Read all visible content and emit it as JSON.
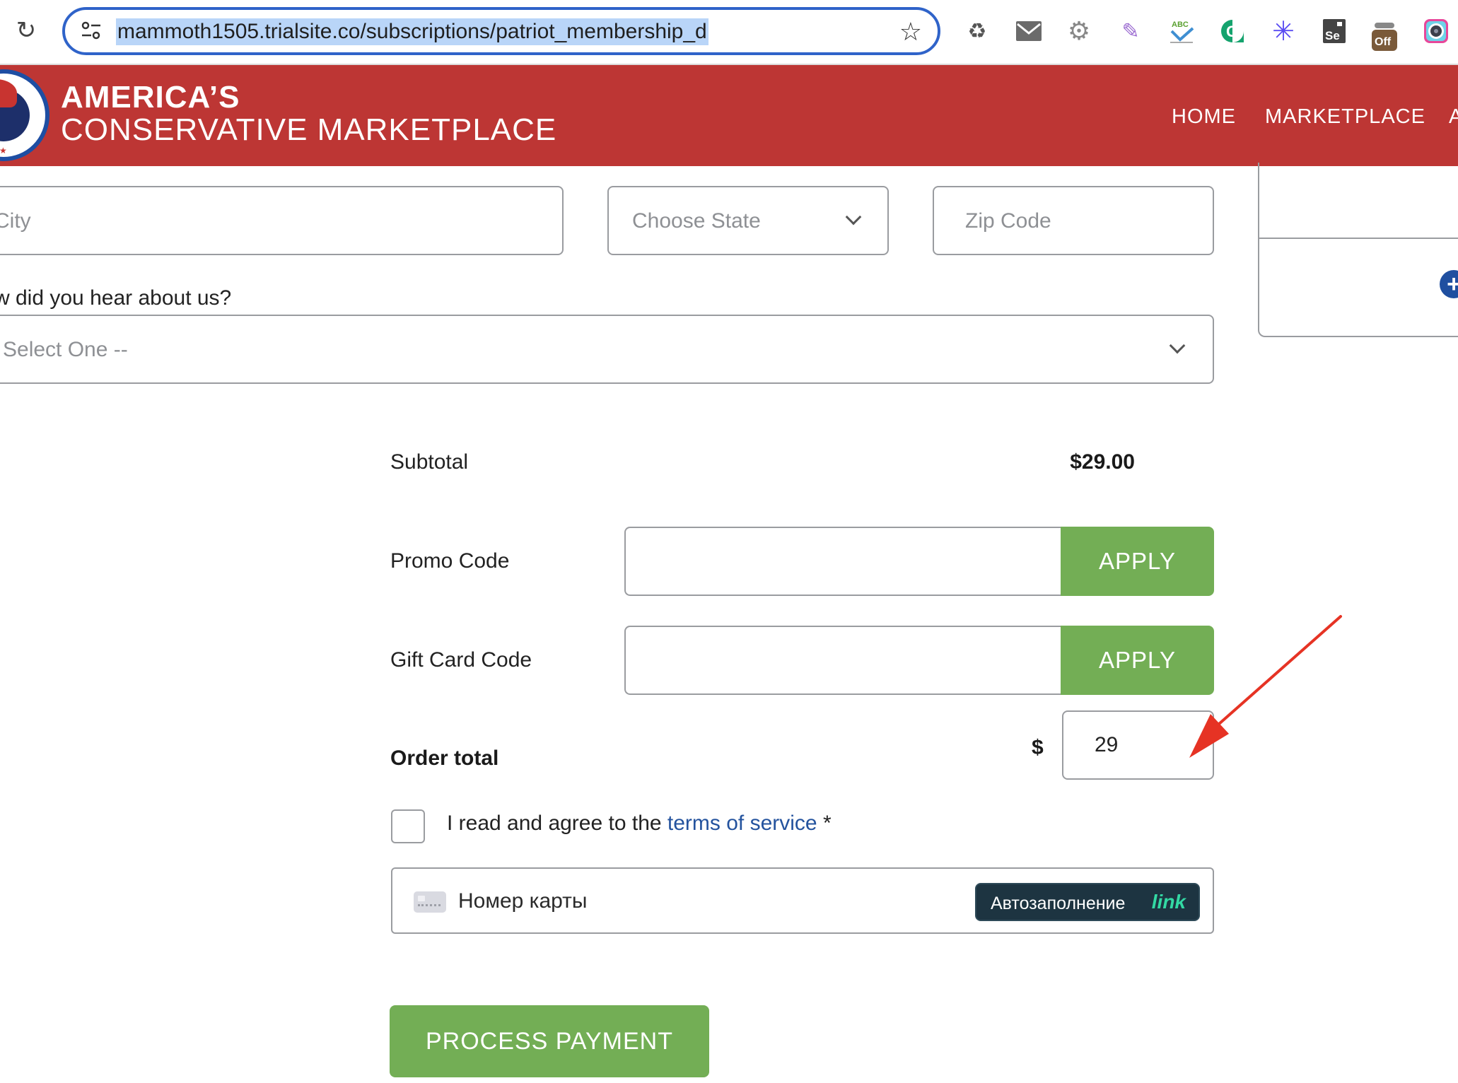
{
  "browser": {
    "url": "mammoth1505.trialsite.co/subscriptions/patriot_membership_d",
    "reload_icon": "reload-icon",
    "site_settings_icon": "tune-icon",
    "bookmark_icon": "star-icon",
    "extensions": [
      {
        "name": "recycle-extension",
        "glyph": "♻"
      },
      {
        "name": "mail-extension",
        "glyph": "✉"
      },
      {
        "name": "gear-extension",
        "glyph": "⚙"
      },
      {
        "name": "feather-extension",
        "glyph": "✎"
      },
      {
        "name": "spellcheck-extension",
        "glyph": "ABC"
      },
      {
        "name": "grammarly-extension",
        "glyph": "G"
      },
      {
        "name": "burst-extension",
        "glyph": "✳"
      },
      {
        "name": "selenium-extension",
        "glyph": "Se"
      },
      {
        "name": "off-extension",
        "glyph": "Off"
      },
      {
        "name": "camera-extension",
        "glyph": "◉"
      }
    ]
  },
  "header": {
    "brand_line1": "AMERICA’S",
    "brand_line2": "CONSERVATIVE MARKETPLACE",
    "logo_stars": "★★★★★",
    "nav": [
      "HOME",
      "MARKETPLACE",
      "A"
    ],
    "color": "#bd3634"
  },
  "address": {
    "city_placeholder": "City",
    "state_placeholder": "Choose State",
    "zip_placeholder": "Zip Code"
  },
  "referral": {
    "label": "How did you hear about us?",
    "label_visible": "w did you hear about us?",
    "selected": "-- Select One --",
    "selected_visible": "Select One --"
  },
  "side_panel": {
    "add_icon": "+"
  },
  "summary": {
    "subtotal_label": "Subtotal",
    "subtotal_value": "$29.00",
    "promo_label": "Promo Code",
    "promo_value": "",
    "promo_apply": "APPLY",
    "gift_label": "Gift Card Code",
    "gift_value": "",
    "gift_apply": "APPLY",
    "order_total_label": "Order total",
    "currency_symbol": "$",
    "order_total_value": "29",
    "accent_color": "#73ae55"
  },
  "terms": {
    "checked": false,
    "prefix": "I read and agree to the ",
    "link": "terms of service",
    "suffix": " *"
  },
  "payment": {
    "card_placeholder": "Номер карты",
    "autofill_label": "Автозаполнение",
    "autofill_brand": "link",
    "process_button": "PROCESS PAYMENT"
  },
  "annotation": {
    "type": "arrow",
    "color": "#e63324",
    "points_to": "order-total-input"
  }
}
